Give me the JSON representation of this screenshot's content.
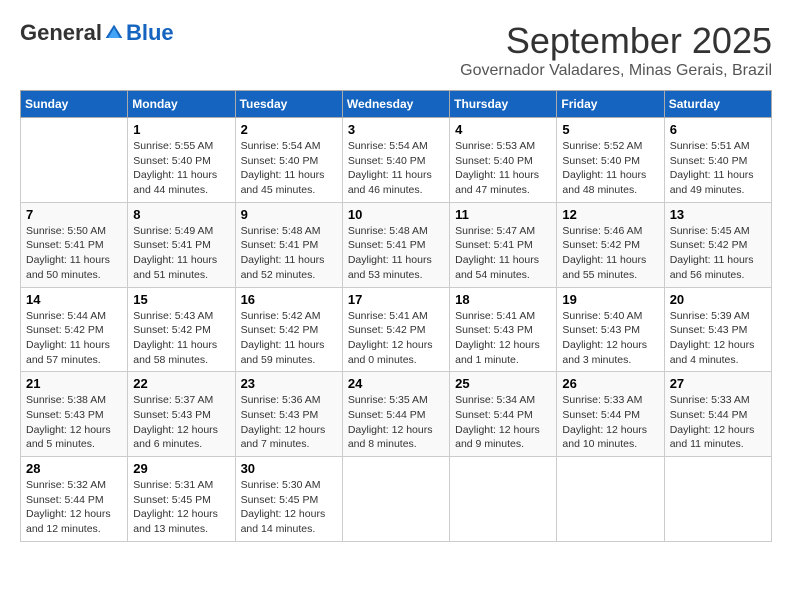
{
  "header": {
    "logo_general": "General",
    "logo_blue": "Blue",
    "month_title": "September 2025",
    "location": "Governador Valadares, Minas Gerais, Brazil"
  },
  "weekdays": [
    "Sunday",
    "Monday",
    "Tuesday",
    "Wednesday",
    "Thursday",
    "Friday",
    "Saturday"
  ],
  "weeks": [
    [
      {
        "day": "",
        "sunrise": "",
        "sunset": "",
        "daylight": ""
      },
      {
        "day": "1",
        "sunrise": "Sunrise: 5:55 AM",
        "sunset": "Sunset: 5:40 PM",
        "daylight": "Daylight: 11 hours and 44 minutes."
      },
      {
        "day": "2",
        "sunrise": "Sunrise: 5:54 AM",
        "sunset": "Sunset: 5:40 PM",
        "daylight": "Daylight: 11 hours and 45 minutes."
      },
      {
        "day": "3",
        "sunrise": "Sunrise: 5:54 AM",
        "sunset": "Sunset: 5:40 PM",
        "daylight": "Daylight: 11 hours and 46 minutes."
      },
      {
        "day": "4",
        "sunrise": "Sunrise: 5:53 AM",
        "sunset": "Sunset: 5:40 PM",
        "daylight": "Daylight: 11 hours and 47 minutes."
      },
      {
        "day": "5",
        "sunrise": "Sunrise: 5:52 AM",
        "sunset": "Sunset: 5:40 PM",
        "daylight": "Daylight: 11 hours and 48 minutes."
      },
      {
        "day": "6",
        "sunrise": "Sunrise: 5:51 AM",
        "sunset": "Sunset: 5:40 PM",
        "daylight": "Daylight: 11 hours and 49 minutes."
      }
    ],
    [
      {
        "day": "7",
        "sunrise": "Sunrise: 5:50 AM",
        "sunset": "Sunset: 5:41 PM",
        "daylight": "Daylight: 11 hours and 50 minutes."
      },
      {
        "day": "8",
        "sunrise": "Sunrise: 5:49 AM",
        "sunset": "Sunset: 5:41 PM",
        "daylight": "Daylight: 11 hours and 51 minutes."
      },
      {
        "day": "9",
        "sunrise": "Sunrise: 5:48 AM",
        "sunset": "Sunset: 5:41 PM",
        "daylight": "Daylight: 11 hours and 52 minutes."
      },
      {
        "day": "10",
        "sunrise": "Sunrise: 5:48 AM",
        "sunset": "Sunset: 5:41 PM",
        "daylight": "Daylight: 11 hours and 53 minutes."
      },
      {
        "day": "11",
        "sunrise": "Sunrise: 5:47 AM",
        "sunset": "Sunset: 5:41 PM",
        "daylight": "Daylight: 11 hours and 54 minutes."
      },
      {
        "day": "12",
        "sunrise": "Sunrise: 5:46 AM",
        "sunset": "Sunset: 5:42 PM",
        "daylight": "Daylight: 11 hours and 55 minutes."
      },
      {
        "day": "13",
        "sunrise": "Sunrise: 5:45 AM",
        "sunset": "Sunset: 5:42 PM",
        "daylight": "Daylight: 11 hours and 56 minutes."
      }
    ],
    [
      {
        "day": "14",
        "sunrise": "Sunrise: 5:44 AM",
        "sunset": "Sunset: 5:42 PM",
        "daylight": "Daylight: 11 hours and 57 minutes."
      },
      {
        "day": "15",
        "sunrise": "Sunrise: 5:43 AM",
        "sunset": "Sunset: 5:42 PM",
        "daylight": "Daylight: 11 hours and 58 minutes."
      },
      {
        "day": "16",
        "sunrise": "Sunrise: 5:42 AM",
        "sunset": "Sunset: 5:42 PM",
        "daylight": "Daylight: 11 hours and 59 minutes."
      },
      {
        "day": "17",
        "sunrise": "Sunrise: 5:41 AM",
        "sunset": "Sunset: 5:42 PM",
        "daylight": "Daylight: 12 hours and 0 minutes."
      },
      {
        "day": "18",
        "sunrise": "Sunrise: 5:41 AM",
        "sunset": "Sunset: 5:43 PM",
        "daylight": "Daylight: 12 hours and 1 minute."
      },
      {
        "day": "19",
        "sunrise": "Sunrise: 5:40 AM",
        "sunset": "Sunset: 5:43 PM",
        "daylight": "Daylight: 12 hours and 3 minutes."
      },
      {
        "day": "20",
        "sunrise": "Sunrise: 5:39 AM",
        "sunset": "Sunset: 5:43 PM",
        "daylight": "Daylight: 12 hours and 4 minutes."
      }
    ],
    [
      {
        "day": "21",
        "sunrise": "Sunrise: 5:38 AM",
        "sunset": "Sunset: 5:43 PM",
        "daylight": "Daylight: 12 hours and 5 minutes."
      },
      {
        "day": "22",
        "sunrise": "Sunrise: 5:37 AM",
        "sunset": "Sunset: 5:43 PM",
        "daylight": "Daylight: 12 hours and 6 minutes."
      },
      {
        "day": "23",
        "sunrise": "Sunrise: 5:36 AM",
        "sunset": "Sunset: 5:43 PM",
        "daylight": "Daylight: 12 hours and 7 minutes."
      },
      {
        "day": "24",
        "sunrise": "Sunrise: 5:35 AM",
        "sunset": "Sunset: 5:44 PM",
        "daylight": "Daylight: 12 hours and 8 minutes."
      },
      {
        "day": "25",
        "sunrise": "Sunrise: 5:34 AM",
        "sunset": "Sunset: 5:44 PM",
        "daylight": "Daylight: 12 hours and 9 minutes."
      },
      {
        "day": "26",
        "sunrise": "Sunrise: 5:33 AM",
        "sunset": "Sunset: 5:44 PM",
        "daylight": "Daylight: 12 hours and 10 minutes."
      },
      {
        "day": "27",
        "sunrise": "Sunrise: 5:33 AM",
        "sunset": "Sunset: 5:44 PM",
        "daylight": "Daylight: 12 hours and 11 minutes."
      }
    ],
    [
      {
        "day": "28",
        "sunrise": "Sunrise: 5:32 AM",
        "sunset": "Sunset: 5:44 PM",
        "daylight": "Daylight: 12 hours and 12 minutes."
      },
      {
        "day": "29",
        "sunrise": "Sunrise: 5:31 AM",
        "sunset": "Sunset: 5:45 PM",
        "daylight": "Daylight: 12 hours and 13 minutes."
      },
      {
        "day": "30",
        "sunrise": "Sunrise: 5:30 AM",
        "sunset": "Sunset: 5:45 PM",
        "daylight": "Daylight: 12 hours and 14 minutes."
      },
      {
        "day": "",
        "sunrise": "",
        "sunset": "",
        "daylight": ""
      },
      {
        "day": "",
        "sunrise": "",
        "sunset": "",
        "daylight": ""
      },
      {
        "day": "",
        "sunrise": "",
        "sunset": "",
        "daylight": ""
      },
      {
        "day": "",
        "sunrise": "",
        "sunset": "",
        "daylight": ""
      }
    ]
  ]
}
